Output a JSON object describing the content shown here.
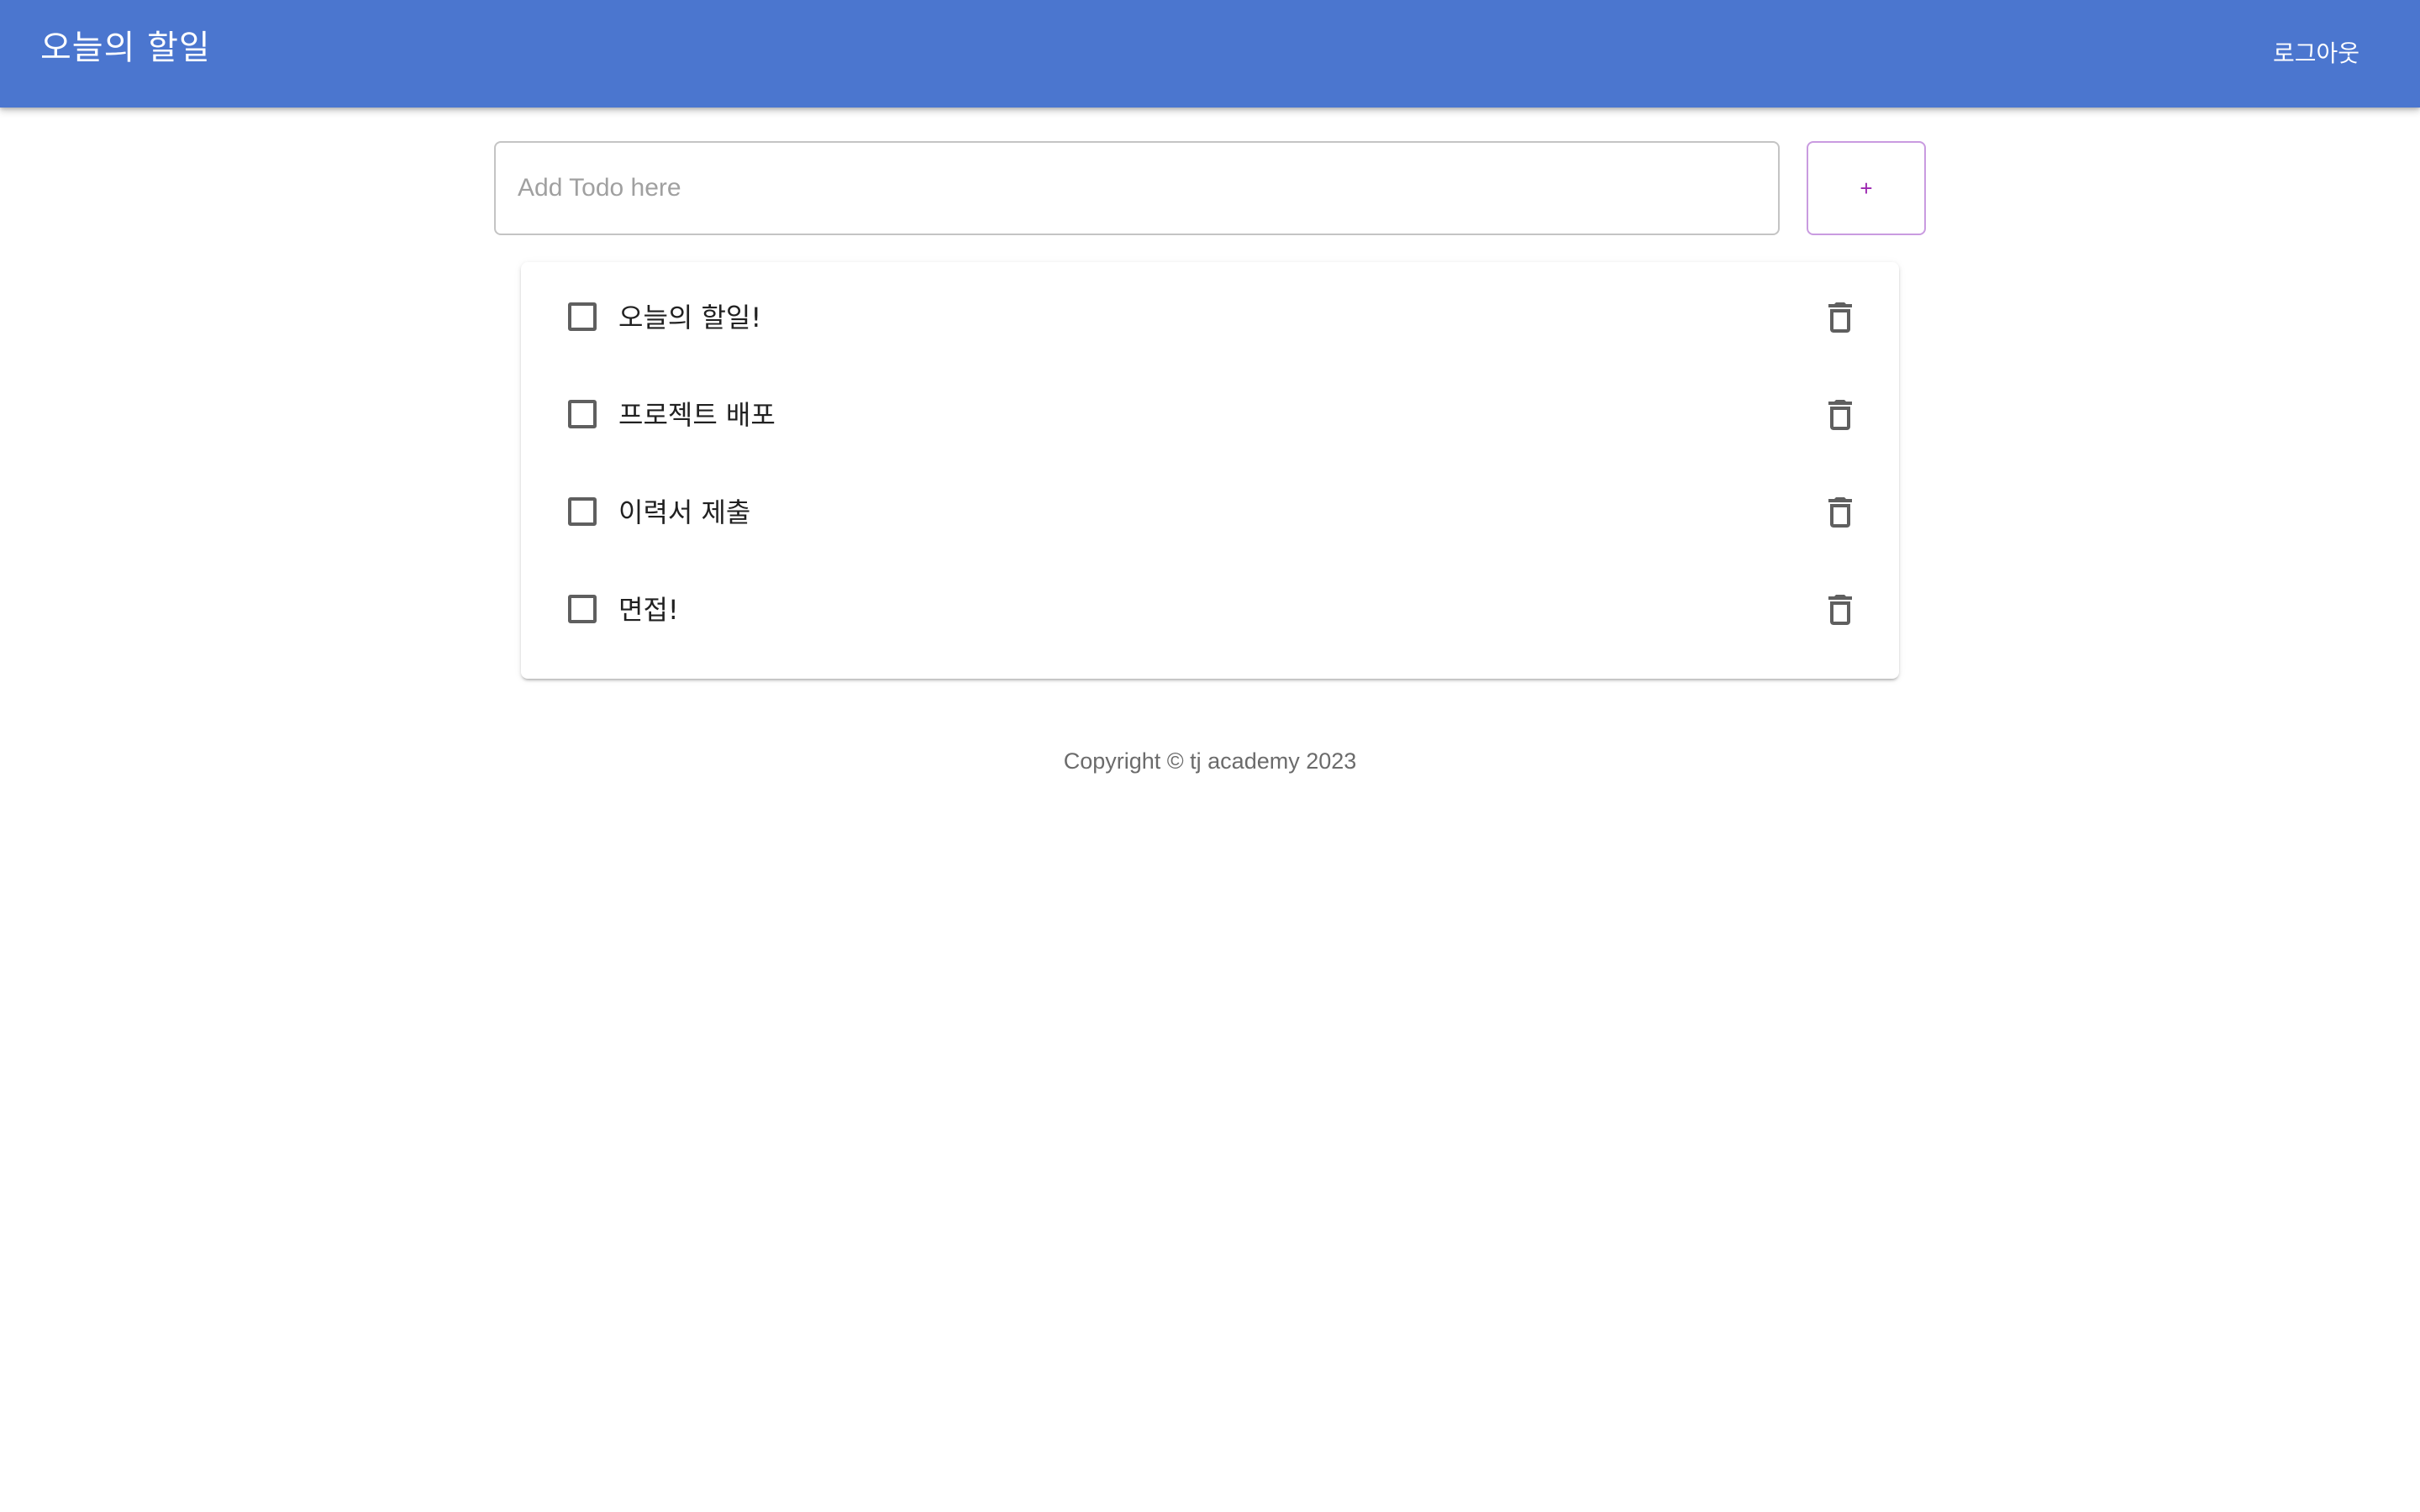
{
  "header": {
    "title": "오늘의 할일",
    "logout_label": "로그아웃",
    "background_color": "#4b76cf"
  },
  "add_todo": {
    "placeholder": "Add Todo here",
    "value": "",
    "add_button_label": "+"
  },
  "todos": [
    {
      "title": "오늘의 할일!",
      "done": false
    },
    {
      "title": "프로젝트 배포",
      "done": false
    },
    {
      "title": "이력서 제출",
      "done": false
    },
    {
      "title": "면접!",
      "done": false
    }
  ],
  "footer": {
    "copyright": "Copyright © tj academy 2023"
  },
  "icons": {
    "delete": "trash-icon",
    "checkbox": "checkbox-outline-icon"
  }
}
